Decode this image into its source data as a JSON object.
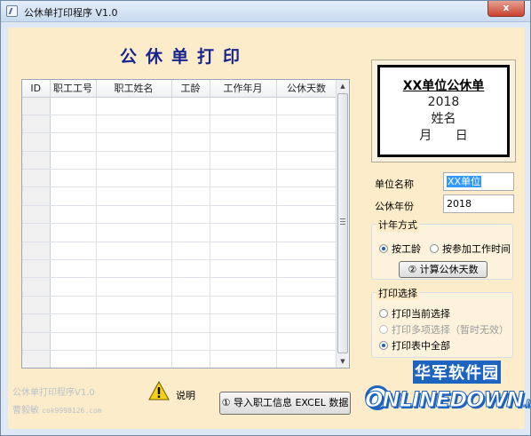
{
  "window": {
    "title": "公休单打印程序 V1.0",
    "close_glyph": "x"
  },
  "header": {
    "title": "公休单打印"
  },
  "grid": {
    "columns": [
      "ID",
      "职工工号",
      "职工姓名",
      "工龄",
      "工作年月",
      "公休天数"
    ],
    "row_count": 15
  },
  "card": {
    "title": "XX单位公休单",
    "year": "2018",
    "name": "姓名",
    "month_day": "月 日"
  },
  "form": {
    "unit_label": "单位名称",
    "unit_value": "XX单位",
    "year_label": "公休年份",
    "year_value": "2018"
  },
  "calc_group": {
    "title": "计年方式",
    "options": [
      "按工龄",
      "按参加工作时间"
    ],
    "selected": "按工龄",
    "button": "② 计算公休天数"
  },
  "print_group": {
    "title": "打印选择",
    "options": [
      "打印当前选择",
      "打印多项选择（暂时无效）",
      "打印表中全部"
    ],
    "selected": "打印表中全部"
  },
  "footer": {
    "faded_line1": "公休单打印程序V1.0",
    "faded_line2_name": "曹毅敏",
    "faded_line2_email": "cok9998126.com",
    "explain": "说明",
    "import_button": "① 导入职工信息 EXCEL 数据"
  },
  "watermark": {
    "top": "华军软件园",
    "bottom": "ONLINEDOWN",
    "suffix": ".NET"
  },
  "colors": {
    "accent": "#17258f",
    "client_bg": "#fdecc9",
    "watermark_blue": "#1d63c0"
  }
}
